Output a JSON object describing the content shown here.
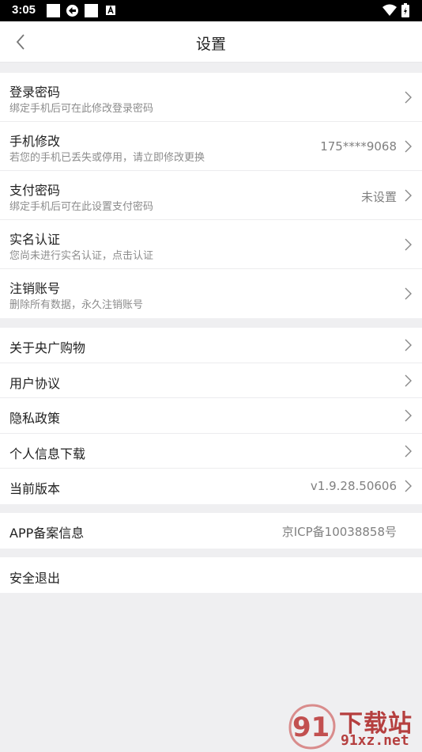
{
  "status_bar": {
    "time": "3:05"
  },
  "header": {
    "title": "设置"
  },
  "account_section": {
    "items": [
      {
        "title": "登录密码",
        "subtitle": "绑定手机后可在此修改登录密码",
        "value": ""
      },
      {
        "title": "手机修改",
        "subtitle": "若您的手机已丢失或停用，请立即修改更换",
        "value": "175****9068"
      },
      {
        "title": "支付密码",
        "subtitle": "绑定手机后可在此设置支付密码",
        "value": "未设置"
      },
      {
        "title": "实名认证",
        "subtitle": "您尚未进行实名认证，点击认证",
        "value": ""
      },
      {
        "title": "注销账号",
        "subtitle": "删除所有数据，永久注销账号",
        "value": ""
      }
    ]
  },
  "about_section": {
    "items": [
      {
        "title": "关于央广购物",
        "value": ""
      },
      {
        "title": "用户协议",
        "value": ""
      },
      {
        "title": "隐私政策",
        "value": ""
      },
      {
        "title": "个人信息下载",
        "value": ""
      },
      {
        "title": "当前版本",
        "value": "v1.9.28.50606"
      }
    ]
  },
  "filing": {
    "title": "APP备案信息",
    "value": "京ICP备10038858号"
  },
  "logout": {
    "label": "安全退出"
  },
  "watermark": {
    "top_text": "下载站",
    "bottom_text": "91xz.net",
    "logo_text": "91"
  },
  "colors": {
    "background": "#efeff1",
    "watermark": "#b53f3f",
    "subtitle": "#8c8c8c"
  }
}
